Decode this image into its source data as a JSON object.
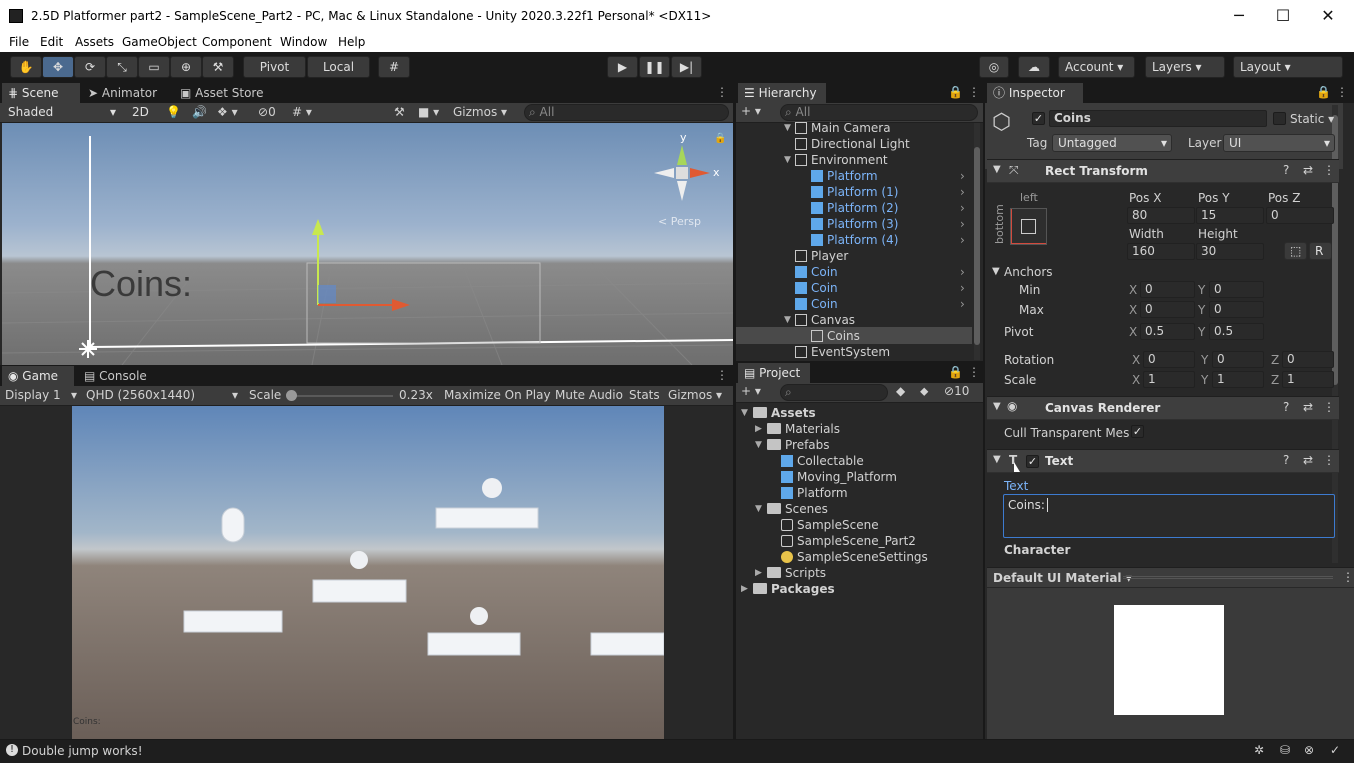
{
  "window": {
    "title": "2.5D Platformer part2 - SampleScene_Part2 - PC, Mac & Linux Standalone - Unity 2020.3.22f1 Personal* <DX11>",
    "min": "─",
    "max": "☐",
    "close": "✕"
  },
  "menu": [
    "File",
    "Edit",
    "Assets",
    "GameObject",
    "Component",
    "Window",
    "Help"
  ],
  "toolbar": {
    "pivot": "Pivot",
    "local": "Local",
    "account": "Account",
    "layers": "Layers",
    "layout": "Layout"
  },
  "scene": {
    "tabs": [
      "Scene",
      "Animator",
      "Asset Store"
    ],
    "shading": "Shaded",
    "mode2d": "2D",
    "fx_count": "0",
    "gizmos": "Gizmos",
    "search": "All",
    "coins_text": "Coins:",
    "persp": "< Persp"
  },
  "game": {
    "tabs": [
      "Game",
      "Console"
    ],
    "display": "Display 1",
    "resolution": "QHD (2560x1440)",
    "scale_label": "Scale",
    "scale_value": "0.23x",
    "scale_level": 0.0,
    "buttons": [
      "Maximize On Play",
      "Mute Audio",
      "Stats",
      "Gizmos"
    ],
    "coins_small": "Coins:"
  },
  "hierarchy": {
    "tab": "Hierarchy",
    "search": "All",
    "items": [
      {
        "label": "Main Camera",
        "blue": false,
        "indent": 0
      },
      {
        "label": "Directional Light",
        "blue": false,
        "indent": 0
      },
      {
        "label": "Environment",
        "blue": false,
        "indent": 0
      },
      {
        "label": "Platform",
        "blue": true,
        "indent": 1
      },
      {
        "label": "Platform (1)",
        "blue": true,
        "indent": 1
      },
      {
        "label": "Platform (2)",
        "blue": true,
        "indent": 1
      },
      {
        "label": "Platform (3)",
        "blue": true,
        "indent": 1
      },
      {
        "label": "Platform (4)",
        "blue": true,
        "indent": 1
      },
      {
        "label": "Player",
        "blue": false,
        "indent": 0
      },
      {
        "label": "Coin",
        "blue": true,
        "indent": 0
      },
      {
        "label": "Coin",
        "blue": true,
        "indent": 0
      },
      {
        "label": "Coin",
        "blue": true,
        "indent": 0
      },
      {
        "label": "Canvas",
        "blue": false,
        "indent": 0
      },
      {
        "label": "Coins",
        "blue": false,
        "indent": 1
      },
      {
        "label": "EventSystem",
        "blue": false,
        "indent": 0
      }
    ]
  },
  "project": {
    "tab": "Project",
    "count": "10",
    "items": [
      {
        "label": "Assets",
        "type": "folder",
        "indent": 0
      },
      {
        "label": "Materials",
        "type": "folder",
        "indent": 1
      },
      {
        "label": "Prefabs",
        "type": "folder",
        "indent": 1
      },
      {
        "label": "Collectable",
        "type": "prefab",
        "indent": 2
      },
      {
        "label": "Moving_Platform",
        "type": "prefab",
        "indent": 2
      },
      {
        "label": "Platform",
        "type": "prefab",
        "indent": 2
      },
      {
        "label": "Scenes",
        "type": "folder",
        "indent": 1
      },
      {
        "label": "SampleScene",
        "type": "scene",
        "indent": 2
      },
      {
        "label": "SampleScene_Part2",
        "type": "scene",
        "indent": 2
      },
      {
        "label": "SampleSceneSettings",
        "type": "settings",
        "indent": 2
      },
      {
        "label": "Scripts",
        "type": "folder",
        "indent": 1
      },
      {
        "label": "Packages",
        "type": "folder",
        "indent": 0
      }
    ]
  },
  "inspector": {
    "tab": "Inspector",
    "name": "Coins",
    "static": "Static",
    "tag_label": "Tag",
    "tag": "Untagged",
    "layer_label": "Layer",
    "layer": "UI",
    "rect": {
      "title": "Rect Transform",
      "anchor_h": "left",
      "anchor_v": "bottom",
      "posx_l": "Pos X",
      "posy_l": "Pos Y",
      "posz_l": "Pos Z",
      "posx": "80",
      "posy": "15",
      "posz": "0",
      "width_l": "Width",
      "height_l": "Height",
      "width": "160",
      "height": "30",
      "r": "R",
      "anchors": "Anchors",
      "min": "Min",
      "max": "Max",
      "minx": "0",
      "miny": "0",
      "maxx": "0",
      "maxy": "0",
      "pivot": "Pivot",
      "pivx": "0.5",
      "pivy": "0.5",
      "rotation": "Rotation",
      "rx": "0",
      "ry": "0",
      "rz": "0",
      "scale": "Scale",
      "sx": "1",
      "sy": "1",
      "sz": "1",
      "x": "X",
      "y": "Y",
      "z": "Z"
    },
    "canvas_renderer": {
      "title": "Canvas Renderer",
      "cull": "Cull Transparent Mesh"
    },
    "text": {
      "title": "Text",
      "text_label": "Text",
      "value": "Coins:",
      "character": "Character"
    },
    "material": "Default UI Material"
  },
  "status": {
    "message": "Double jump works!"
  },
  "colors": {
    "accent": "#4b6a8f",
    "blue_prefab": "#7cb4f8"
  }
}
